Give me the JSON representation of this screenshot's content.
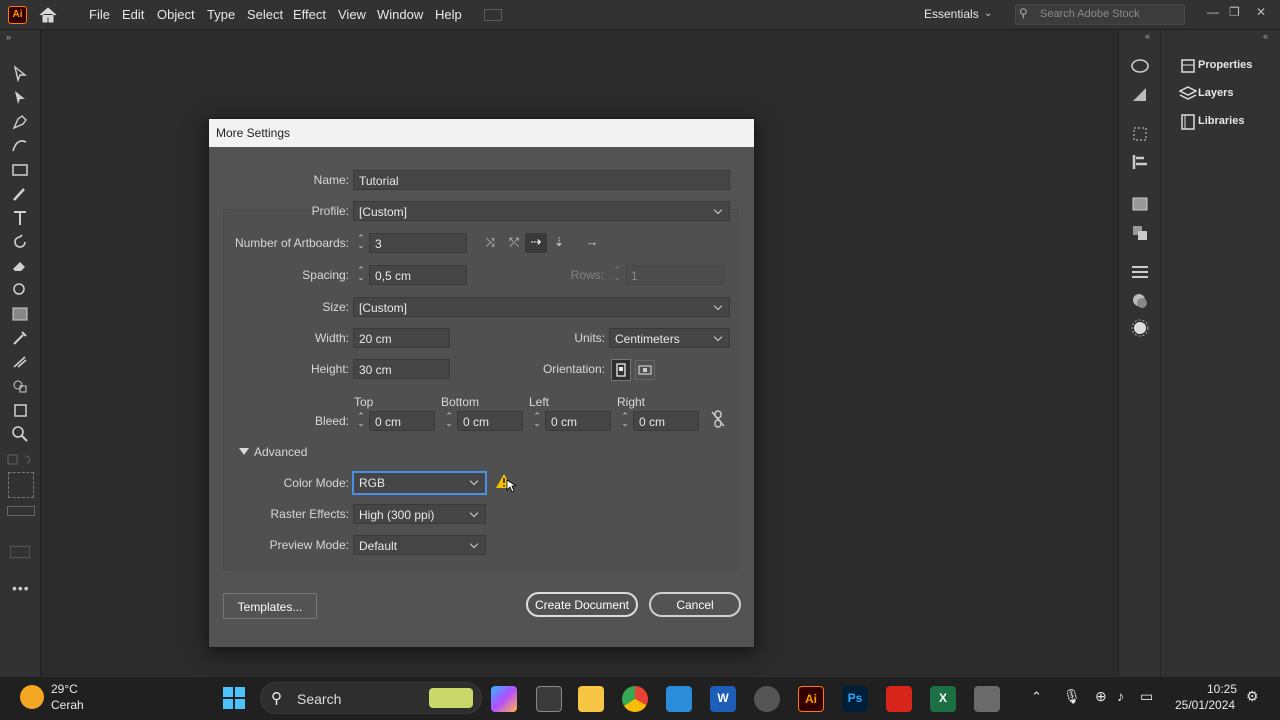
{
  "app": {
    "logo_text": "Ai",
    "menus": [
      "File",
      "Edit",
      "Object",
      "Type",
      "Select",
      "Effect",
      "View",
      "Window",
      "Help"
    ],
    "workspace": "Essentials",
    "stock_search_placeholder": "Search Adobe Stock"
  },
  "right_panel": {
    "tabs": [
      "Properties",
      "Layers",
      "Libraries"
    ]
  },
  "dialog": {
    "title": "More Settings",
    "name_label": "Name:",
    "name_value": "Tutorial",
    "profile_label": "Profile:",
    "profile_value": "[Custom]",
    "artboards_label": "Number of Artboards:",
    "artboards_value": "3",
    "spacing_label": "Spacing:",
    "spacing_value": "0,5 cm",
    "rows_label": "Rows:",
    "rows_value": "1",
    "size_label": "Size:",
    "size_value": "[Custom]",
    "width_label": "Width:",
    "width_value": "20 cm",
    "units_label": "Units:",
    "units_value": "Centimeters",
    "height_label": "Height:",
    "height_value": "30 cm",
    "orientation_label": "Orientation:",
    "bleed_label": "Bleed:",
    "bleed": {
      "top_label": "Top",
      "top_value": "0 cm",
      "bottom_label": "Bottom",
      "bottom_value": "0 cm",
      "left_label": "Left",
      "left_value": "0 cm",
      "right_label": "Right",
      "right_value": "0 cm"
    },
    "advanced_label": "Advanced",
    "color_mode_label": "Color Mode:",
    "color_mode_value": "RGB",
    "raster_label": "Raster Effects:",
    "raster_value": "High (300 ppi)",
    "preview_label": "Preview Mode:",
    "preview_value": "Default",
    "templates_button": "Templates...",
    "create_button": "Create Document",
    "cancel_button": "Cancel"
  },
  "taskbar": {
    "weather_temp": "29°C",
    "weather_desc": "Cerah",
    "search_label": "Search",
    "time": "10:25",
    "date": "25/01/2024"
  },
  "colors": {
    "accent_warning": "#f2c200",
    "ai_orange": "#ff9a00",
    "focus_blue": "#4a8fe7"
  }
}
